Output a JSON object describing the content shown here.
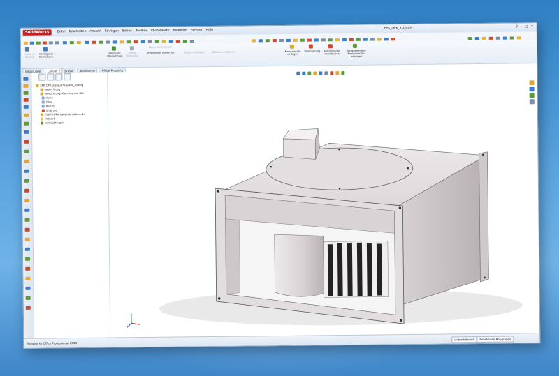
{
  "app": {
    "logo": "SolidWorks",
    "window_title": "EPK_DPK_3LD40H *"
  },
  "menu": [
    "Datei",
    "Bearbeiten",
    "Ansicht",
    "Einfügen",
    "Extras",
    "Toolbox",
    "PhotoWorks",
    "Blueprint",
    "Fenster",
    "Hilfe"
  ],
  "window_buttons": [
    "?",
    "-",
    "□",
    "×"
  ],
  "commands": [
    {
      "label": "Linearer Bauteil-",
      "gray": true
    },
    {
      "label": "Intelligente Bemaßung",
      "gray": false
    },
    {
      "label": "Elemente übernehmen",
      "gray": false
    },
    {
      "label": "Offset Elemente",
      "gray": true
    },
    {
      "label": "Elemente trimmen",
      "gray": true
    },
    {
      "label": "Umwandeln Elemente",
      "gray": false
    },
    {
      "label": "Skizze schließen",
      "gray": true
    },
    {
      "label": "Zusammenführen",
      "gray": true
    },
    {
      "label": "Komponente einfügen",
      "gray": false
    },
    {
      "label": "Verknüpfung",
      "gray": false
    },
    {
      "label": "Komponente verschieben",
      "gray": false
    },
    {
      "label": "Ausgeblendete Komponenten anzeigen",
      "gray": false
    }
  ],
  "tabs": [
    "Baugruppe",
    "Layout",
    "Skizze",
    "Evaluieren",
    "Office Produkte"
  ],
  "active_tab": "Layout",
  "tree": [
    "EPK_DPK (Default<Default_Anzeig",
    "Beschriftung",
    "Beleuchtung, Kameras und Büh",
    "Vorne",
    "Oben",
    "Rechts",
    "Ursprung",
    "(f) EPK-DPK_Kanal-Ventilator<1>",
    "Ordner1",
    "Verknüpfungen"
  ],
  "status": {
    "left": "SolidWorks Office Professional 2008",
    "state": "Unterdefiniert",
    "mode": "Bearbeiten Baugruppe"
  },
  "colors": {
    "accent": "#c8201f",
    "ui": "#dfe7f1",
    "model": "#cfc9cb"
  }
}
